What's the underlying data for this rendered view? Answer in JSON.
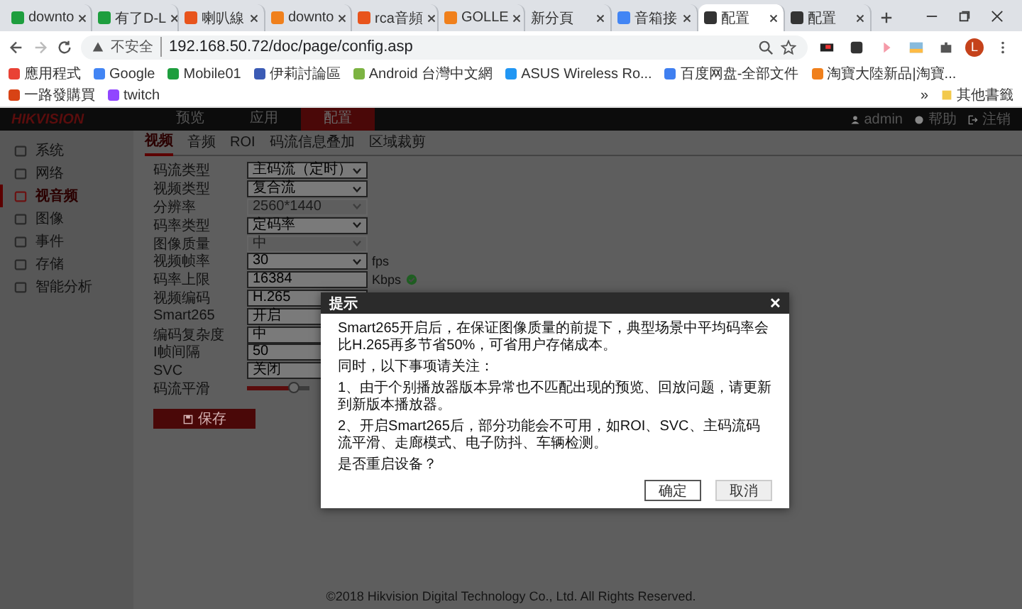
{
  "browser": {
    "tabs": [
      {
        "title": "downto",
        "color": "#1e9e3e",
        "selected": false
      },
      {
        "title": "有了D-L",
        "color": "#1e9e3e",
        "selected": false
      },
      {
        "title": "喇叭線",
        "color": "#e8541c",
        "selected": false
      },
      {
        "title": "downto",
        "color": "#f0801c",
        "selected": false
      },
      {
        "title": "rca音頻",
        "color": "#e8541c",
        "selected": false
      },
      {
        "title": "GOLLE",
        "color": "#f0801c",
        "selected": false
      },
      {
        "title": "新分頁",
        "selected": false
      },
      {
        "title": "音箱接",
        "color": "#4285f4",
        "selected": false
      },
      {
        "title": "配置",
        "color": "#333333",
        "selected": true
      },
      {
        "title": "配置",
        "color": "#333333",
        "selected": false
      }
    ],
    "security": "不安全",
    "url": "192.168.50.72/doc/page/config.asp",
    "profile": "L",
    "bookmarks": [
      {
        "label": "應用程式",
        "color": "#e94235"
      },
      {
        "label": "Google",
        "color": "#4285f4"
      },
      {
        "label": "Mobile01",
        "color": "#1e9e3e"
      },
      {
        "label": "伊莉討論區",
        "color": "#3b5bb5"
      },
      {
        "label": "Android 台灣中文網",
        "color": "#7cb342"
      },
      {
        "label": "ASUS Wireless Ro...",
        "color": "#2196f3"
      },
      {
        "label": "百度网盘-全部文件",
        "color": "#3f7ff0"
      },
      {
        "label": "淘寶大陸新品|淘寶...",
        "color": "#f0801c"
      },
      {
        "label": "一路發購買",
        "color": "#d84315"
      },
      {
        "label": "twitch",
        "color": "#9146ff"
      }
    ],
    "more": "»",
    "other_bookmarks": "其他書籤"
  },
  "header": {
    "logo": "HIKVISION",
    "nav": [
      {
        "label": "预览",
        "selected": false
      },
      {
        "label": "应用",
        "selected": false
      },
      {
        "label": "配置",
        "selected": true
      }
    ],
    "user": "admin",
    "help": "帮助",
    "logout": "注销"
  },
  "sidebar": [
    {
      "label": "系统",
      "selected": false
    },
    {
      "label": "网络",
      "selected": false
    },
    {
      "label": "视音频",
      "selected": true
    },
    {
      "label": "图像",
      "selected": false
    },
    {
      "label": "事件",
      "selected": false
    },
    {
      "label": "存储",
      "selected": false
    },
    {
      "label": "智能分析",
      "selected": false
    }
  ],
  "subtabs": [
    {
      "label": "视频",
      "selected": true
    },
    {
      "label": "音频",
      "selected": false
    },
    {
      "label": "ROI",
      "selected": false
    },
    {
      "label": "码流信息叠加",
      "selected": false
    },
    {
      "label": "区域裁剪",
      "selected": false
    }
  ],
  "form": [
    {
      "label": "码流类型",
      "kind": "select",
      "value": "主码流（定时）",
      "disabled": false
    },
    {
      "label": "视频类型",
      "kind": "select",
      "value": "复合流",
      "disabled": false
    },
    {
      "label": "分辨率",
      "kind": "select",
      "value": "2560*1440",
      "disabled": true
    },
    {
      "label": "码率类型",
      "kind": "select",
      "value": "定码率",
      "disabled": false
    },
    {
      "label": "图像质量",
      "kind": "select",
      "value": "中",
      "disabled": true
    },
    {
      "label": "视频帧率",
      "kind": "select",
      "value": "30",
      "disabled": false,
      "unit": "fps"
    },
    {
      "label": "码率上限",
      "kind": "input",
      "value": "16384",
      "disabled": false,
      "unit": "Kbps",
      "valid": true
    },
    {
      "label": "视频编码",
      "kind": "select",
      "value": "H.265",
      "disabled": false
    },
    {
      "label": "Smart265",
      "kind": "select",
      "value": "开启",
      "disabled": false
    },
    {
      "label": "编码复杂度",
      "kind": "select",
      "value": "中",
      "disabled": false
    },
    {
      "label": "I帧间隔",
      "kind": "input",
      "value": "50",
      "disabled": false
    },
    {
      "label": "SVC",
      "kind": "select",
      "value": "关闭",
      "disabled": false
    },
    {
      "label": "码流平滑",
      "kind": "slider",
      "level": 0.75
    }
  ],
  "save": "保存",
  "footer": "©2018 Hikvision Digital Technology Co., Ltd. All Rights Reserved.",
  "dialog": {
    "title": "提示",
    "close": "✕",
    "lines": [
      "Smart265开启后，在保证图像质量的前提下，典型场景中平均码率会比H.265再多节省50%，可省用户存储成本。",
      "同时，以下事项请关注：",
      "1、由于个别播放器版本异常也不匹配出现的预览、回放问题，请更新到新版本播放器。",
      "2、开启Smart265后，部分功能会不可用，如ROI、SVC、主码流码流平滑、走廊模式、电子防抖、车辆检测。",
      "是否重启设备？"
    ],
    "buttons": [
      {
        "label": "确定",
        "kind": "primary"
      },
      {
        "label": "取消",
        "kind": "secondary"
      }
    ]
  }
}
